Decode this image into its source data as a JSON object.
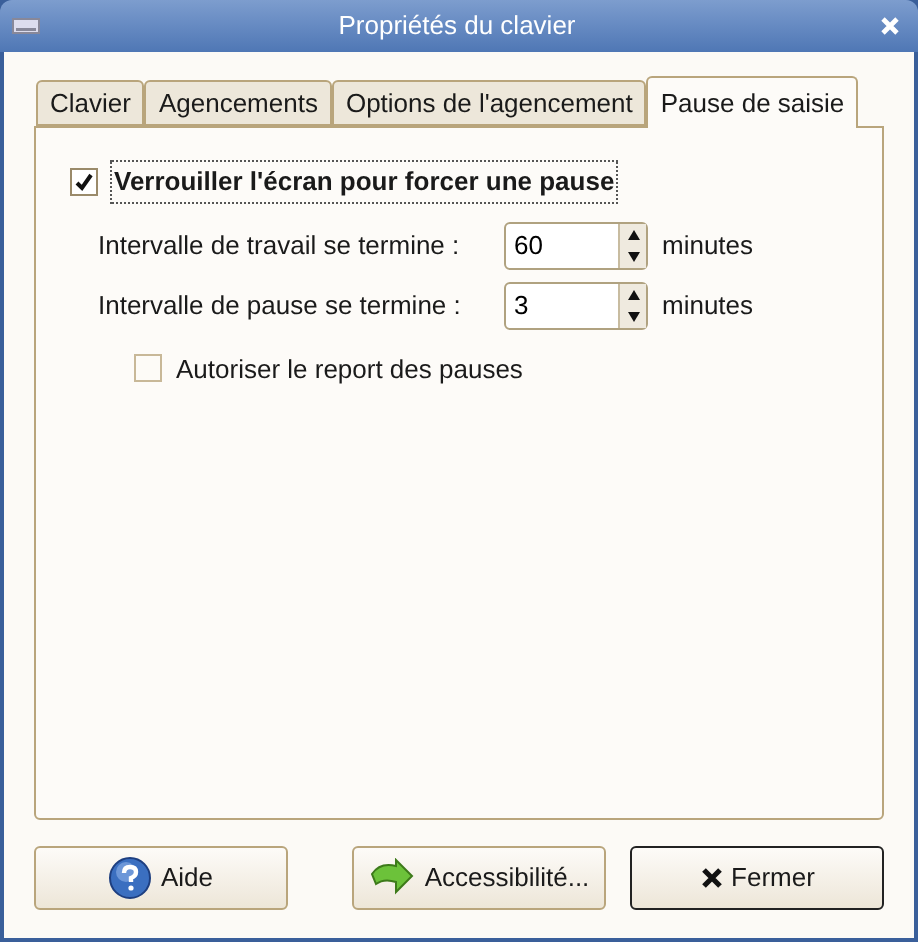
{
  "window": {
    "title": "Propriétés du clavier"
  },
  "tabs": [
    {
      "label": "Clavier",
      "selected": false
    },
    {
      "label": "Agencements",
      "selected": false
    },
    {
      "label": "Options de l'agencement",
      "selected": false
    },
    {
      "label": "Pause de saisie",
      "selected": true
    }
  ],
  "lock_screen": {
    "label": "Verrouiller l'écran pour forcer une pause",
    "checked": true
  },
  "intervals": [
    {
      "label": "Intervalle de travail se termine :",
      "value": "60",
      "unit": "minutes"
    },
    {
      "label": "Intervalle de pause se termine :",
      "value": "3",
      "unit": "minutes"
    }
  ],
  "allow_postpone": {
    "label": "Autoriser le report des pauses",
    "checked": false
  },
  "buttons": [
    {
      "label": "Aide",
      "kind": "help"
    },
    {
      "label": "Accessibilité...",
      "kind": "accessibility"
    },
    {
      "label": "Fermer",
      "kind": "close"
    }
  ]
}
